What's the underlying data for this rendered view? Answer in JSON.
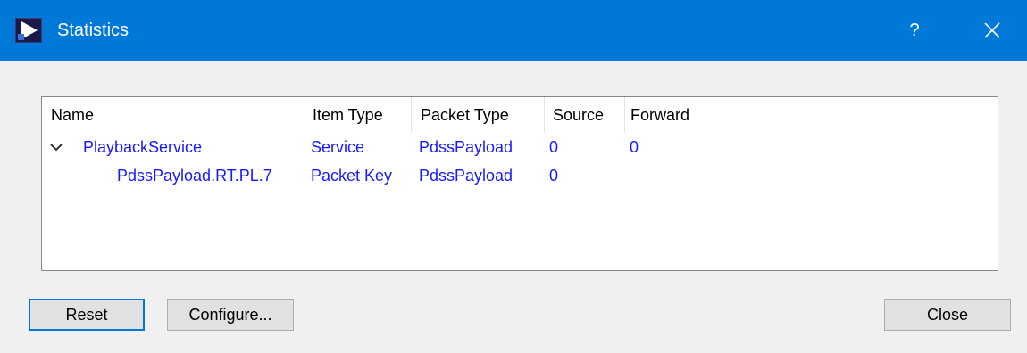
{
  "window": {
    "title": "Statistics",
    "help_label": "?",
    "titlebar_color": "#0078d7",
    "icons": {
      "app": "play-triangle-icon",
      "close": "close-x-icon",
      "expander": "chevron-down-icon"
    }
  },
  "tree": {
    "columns": [
      "Name",
      "Item Type",
      "Packet Type",
      "Source",
      "Forward"
    ],
    "rows": [
      {
        "name": "PlaybackService",
        "item_type": "Service",
        "packet_type": "PdssPayload",
        "source": "0",
        "forward": "0",
        "expanded": true
      },
      {
        "name": "PdssPayload.RT.PL.7",
        "item_type": "Packet Key",
        "packet_type": "PdssPayload",
        "source": "0",
        "forward": ""
      }
    ],
    "text_color": "#1a1aff"
  },
  "buttons": {
    "reset": "Reset",
    "configure": "Configure...",
    "close": "Close"
  }
}
